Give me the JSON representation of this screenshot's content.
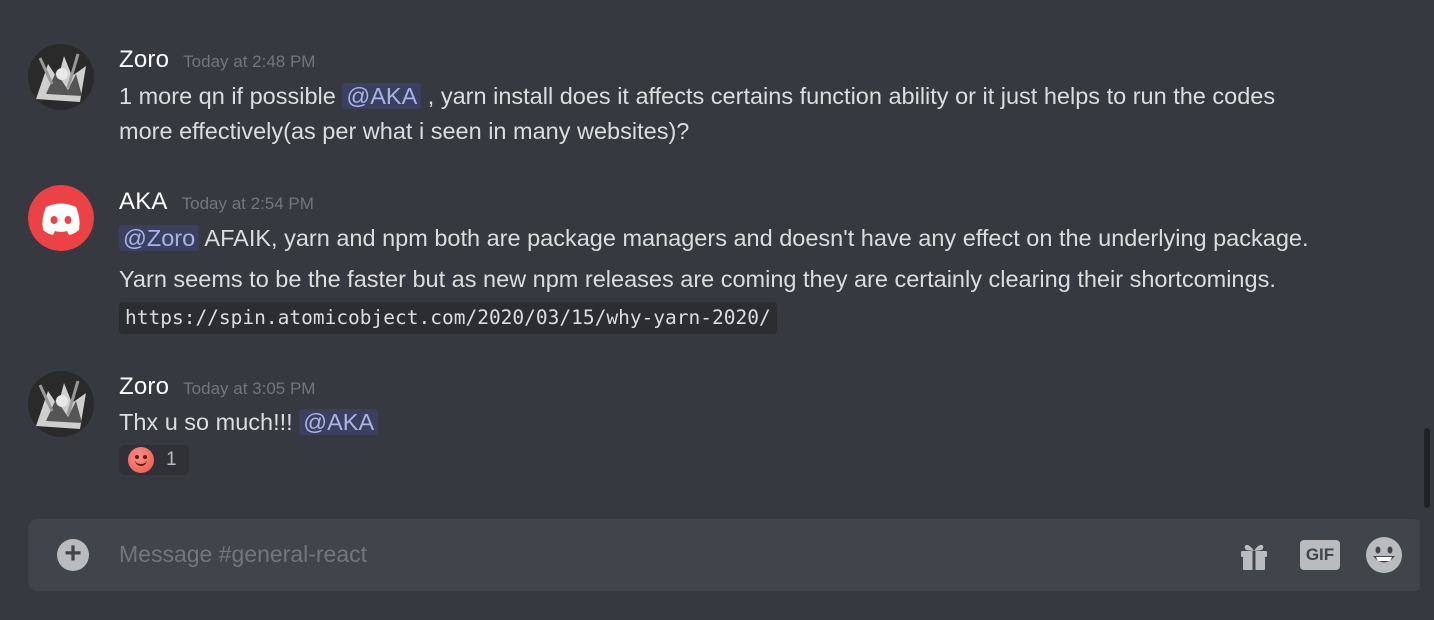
{
  "channel": {
    "placeholder": "Message #general-react"
  },
  "messages": [
    {
      "username": "Zoro",
      "timestamp": "Today at 2:48 PM",
      "line1_pre": "1 more qn if possible ",
      "mention": "@AKA",
      "line1_post": " , yarn install does it affects certains function ability or it just helps to run the codes",
      "line2": "more effectively(as per what i seen in many websites)?"
    },
    {
      "username": "AKA",
      "timestamp": "Today at 2:54 PM",
      "mention": "@Zoro",
      "line1_post": " AFAIK, yarn and npm both are package managers and doesn't have any effect on the underlying package.",
      "line2": "Yarn seems to be the faster but as new npm releases are coming they are certainly clearing their shortcomings.",
      "code": "https://spin.atomicobject.com/2020/03/15/why-yarn-2020/"
    },
    {
      "username": "Zoro",
      "timestamp": "Today at 3:05 PM",
      "line1_pre": "Thx u so much!!! ",
      "mention": "@AKA",
      "reaction": {
        "emoji": "slightly-smiling-face",
        "count": "1"
      }
    }
  ],
  "composer": {
    "add_icon": "plus-circle-icon",
    "gift_icon": "gift-icon",
    "gif_label": "GIF",
    "emoji_icon": "grinning-face-icon"
  },
  "colors": {
    "background": "#36393f",
    "composer": "#40444b",
    "mention_bg": "#3c4270",
    "discord_red": "#ed4245"
  }
}
